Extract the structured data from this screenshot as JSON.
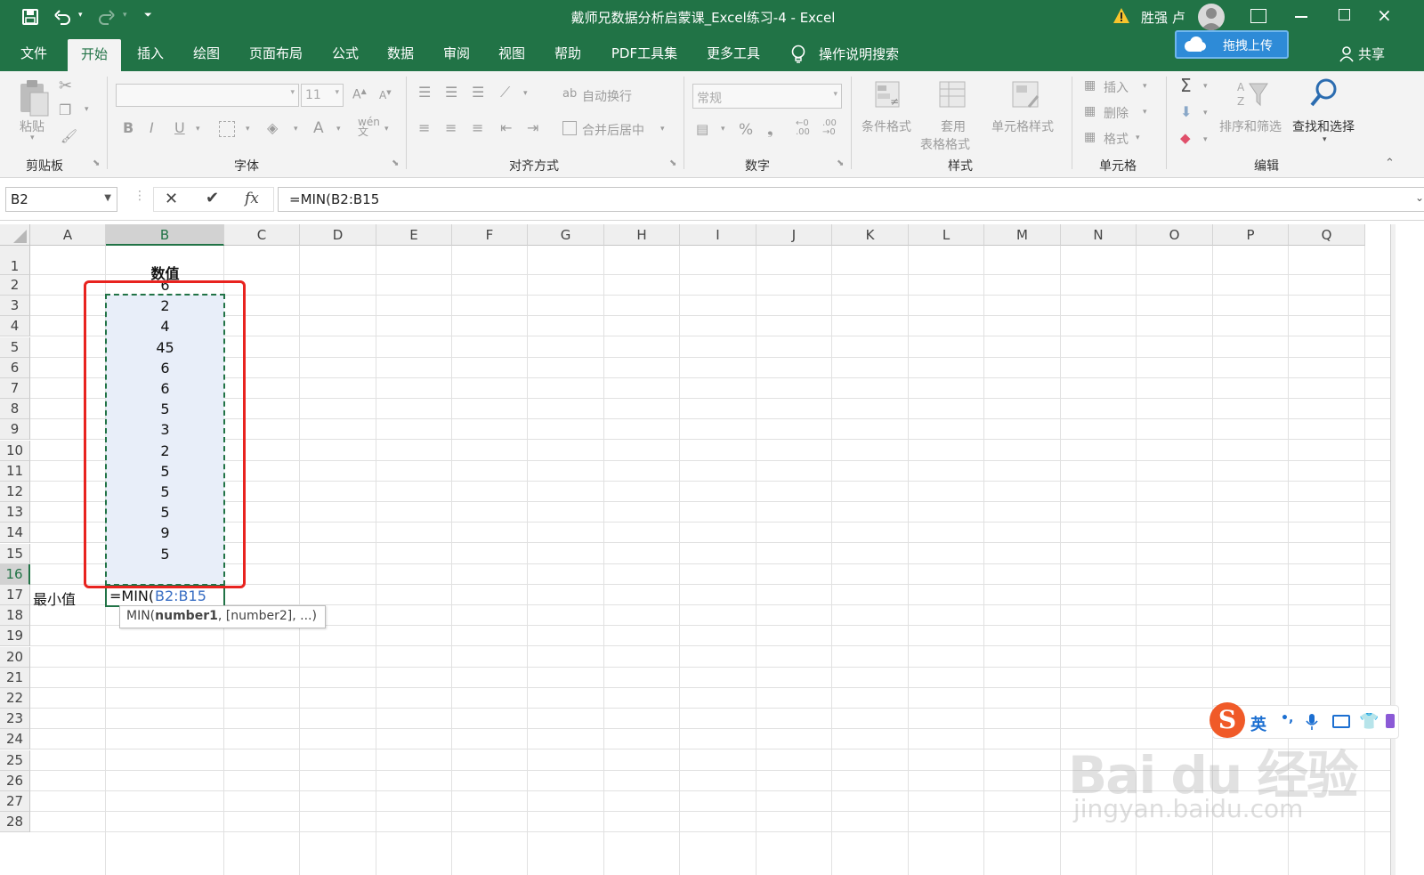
{
  "window": {
    "title": "戴师兄数据分析启蒙课_Excel练习-4  -  Excel",
    "user": "胜强 卢",
    "upload_label": "拖拽上传",
    "share_label": "共享"
  },
  "tabs": [
    "文件",
    "开始",
    "插入",
    "绘图",
    "页面布局",
    "公式",
    "数据",
    "审阅",
    "视图",
    "帮助",
    "PDF工具集",
    "更多工具"
  ],
  "active_tab": "开始",
  "tell_me": "操作说明搜索",
  "ribbon": {
    "clipboard": {
      "label": "剪贴板",
      "paste": "粘贴"
    },
    "font": {
      "label": "字体",
      "size": "11",
      "bold": "B",
      "italic": "I",
      "underline": "U"
    },
    "alignment": {
      "label": "对齐方式",
      "wrap": "自动换行",
      "merge": "合并后居中"
    },
    "number": {
      "label": "数字",
      "format": "常规",
      "percent": "%",
      "comma": "❟"
    },
    "styles": {
      "label": "样式",
      "conditional": "条件格式",
      "table_l1": "套用",
      "table_l2": "表格格式",
      "cell_styles": "单元格样式"
    },
    "cells": {
      "label": "单元格",
      "insert": "插入",
      "delete": "删除",
      "format": "格式"
    },
    "editing": {
      "label": "编辑",
      "sum": "Σ",
      "sort": "排序和筛选",
      "find": "查找和选择"
    }
  },
  "formula_bar": {
    "name_box": "B2",
    "fx": "fx",
    "formula": "=MIN(B2:B15"
  },
  "grid": {
    "columns": [
      "A",
      "B",
      "C",
      "D",
      "E",
      "F",
      "G",
      "H",
      "I",
      "J",
      "K",
      "L",
      "M",
      "N",
      "O",
      "P",
      "Q"
    ],
    "selected_column": "B",
    "rows": [
      "1",
      "2",
      "3",
      "4",
      "5",
      "6",
      "7",
      "8",
      "9",
      "10",
      "11",
      "12",
      "13",
      "14",
      "15",
      "16",
      "17",
      "18",
      "19",
      "20",
      "21",
      "22",
      "23",
      "24",
      "25",
      "26",
      "27",
      "28"
    ],
    "header_cell": "数值",
    "values": [
      "6",
      "2",
      "4",
      "45",
      "6",
      "6",
      "5",
      "3",
      "2",
      "5",
      "5",
      "5",
      "9",
      "5"
    ],
    "label_cell": "最小值",
    "editing_prefix": "=MIN(",
    "editing_ref": "B2:B15",
    "tooltip_func": "MIN(",
    "tooltip_bold": "number1",
    "tooltip_rest": ", [number2], ...)"
  },
  "ime": {
    "label": "英",
    "punct": "•,"
  },
  "watermark": {
    "brand": "Bai du 经验",
    "url": "jingyan.baidu.com"
  },
  "colors": {
    "excel_green": "#217346",
    "selection_fill": "#e8eef9",
    "highlight_red": "#e8231f"
  }
}
